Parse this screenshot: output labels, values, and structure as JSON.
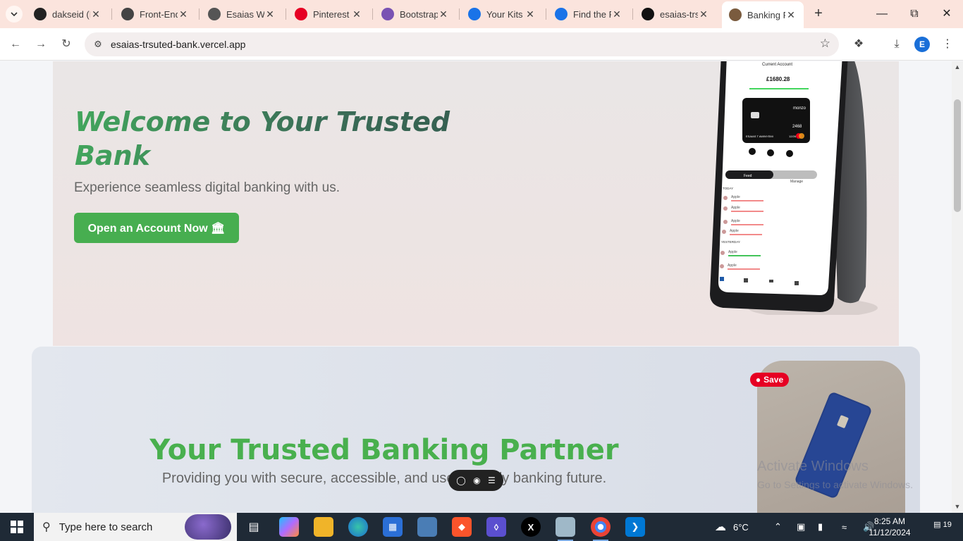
{
  "browser": {
    "tabs": [
      {
        "title": "dakseid (E",
        "favicon": "github-icon",
        "color": "#222222"
      },
      {
        "title": "Front-End",
        "favicon": "openai-icon",
        "color": "#444444"
      },
      {
        "title": "Esaias Wo",
        "favicon": "globe-icon",
        "color": "#555555"
      },
      {
        "title": "Pinterest",
        "favicon": "pinterest-icon",
        "color": "#e60023"
      },
      {
        "title": "Bootstrap",
        "favicon": "bootstrap-icon",
        "color": "#7952b3"
      },
      {
        "title": "Your Kits",
        "favicon": "flag-icon",
        "color": "#1a73e8"
      },
      {
        "title": "Find the F",
        "favicon": "flag-icon",
        "color": "#1a73e8"
      },
      {
        "title": "esaias-trs",
        "favicon": "vercel-icon",
        "color": "#111111"
      },
      {
        "title": "Banking P",
        "favicon": "site-icon",
        "color": "#7a5b3e",
        "active": true
      }
    ],
    "url": "esaias-trsuted-bank.vercel.app",
    "profile_initial": "E"
  },
  "page": {
    "hero": {
      "title": "Welcome to Your Trusted Bank",
      "subtitle": "Experience seamless digital banking with us.",
      "cta_label": "Open an Account Now 🏛",
      "phone": {
        "account_label": "Current Account",
        "balance": "£1680.28",
        "card_brand": "monzo",
        "card_digits": "2468",
        "card_holder": "ESAIAS T AWINYEMI",
        "card_expiry": "12/26",
        "tabs": [
          "Feed",
          "Manage"
        ],
        "today_label": "TODAY",
        "yesterday_label": "YESTERDAY",
        "merchant": "Apple"
      }
    },
    "partner": {
      "title": "Your Trusted Banking Partner",
      "subtitle": "Providing you with secure, accessible, and user-friendly banking future.",
      "save_label": "Save"
    },
    "watermark": {
      "line1": "Activate Windows",
      "line2": "Go to Settings to activate Windows."
    }
  },
  "taskbar": {
    "search_placeholder": "Type here to search",
    "weather": "6°C",
    "time": "8:25 AM",
    "date": "11/12/2024",
    "notifications": "19"
  }
}
